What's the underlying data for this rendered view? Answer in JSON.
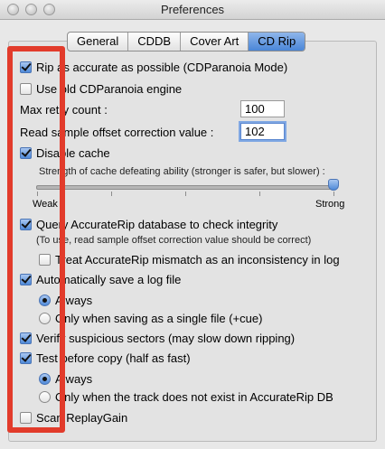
{
  "window": {
    "title": "Preferences"
  },
  "tabs": [
    {
      "label": "General",
      "active": false
    },
    {
      "label": "CDDB",
      "active": false
    },
    {
      "label": "Cover Art",
      "active": false
    },
    {
      "label": "CD Rip",
      "active": true
    }
  ],
  "options": {
    "rip_accurate": {
      "label": "Rip as accurate as possible (CDParanoia Mode)",
      "checked": true
    },
    "old_engine": {
      "label": "Use old CDParanoia engine",
      "checked": false
    },
    "max_retry": {
      "label": "Max retry count :",
      "value": "100"
    },
    "offset": {
      "label": "Read sample offset correction value :",
      "value": "102"
    },
    "disable_cache": {
      "label": "Disable cache",
      "checked": true
    },
    "cache_strength": {
      "label": "Strength of cache defeating ability (stronger is safer, but slower) :",
      "min_label": "Weak",
      "max_label": "Strong",
      "level": 1.0
    },
    "query_accuraterip": {
      "label": "Query AccurateRip database to check integrity",
      "checked": true,
      "note": "(To use, read sample offset correction value should be correct)"
    },
    "treat_mismatch": {
      "label": "Treat AccurateRip mismatch as an inconsistency in log",
      "checked": false
    },
    "auto_log": {
      "label": "Automatically save a log file",
      "checked": true
    },
    "log_always": {
      "label": "Always",
      "selected": true
    },
    "log_single_file": {
      "label": "Only when saving as a single file (+cue)",
      "selected": false
    },
    "verify_sectors": {
      "label": "Verify suspicious sectors (may slow down ripping)",
      "checked": true
    },
    "test_before_copy": {
      "label": "Test before copy (half as fast)",
      "checked": true
    },
    "test_always": {
      "label": "Always",
      "selected": true
    },
    "test_not_in_db": {
      "label": "Only when the track does not exist in AccurateRip DB",
      "selected": false
    },
    "scan_replaygain": {
      "label": "Scan ReplayGain",
      "checked": false
    }
  },
  "colors": {
    "highlight_box": "#e23b2b",
    "accent": "#4f8ad9"
  }
}
